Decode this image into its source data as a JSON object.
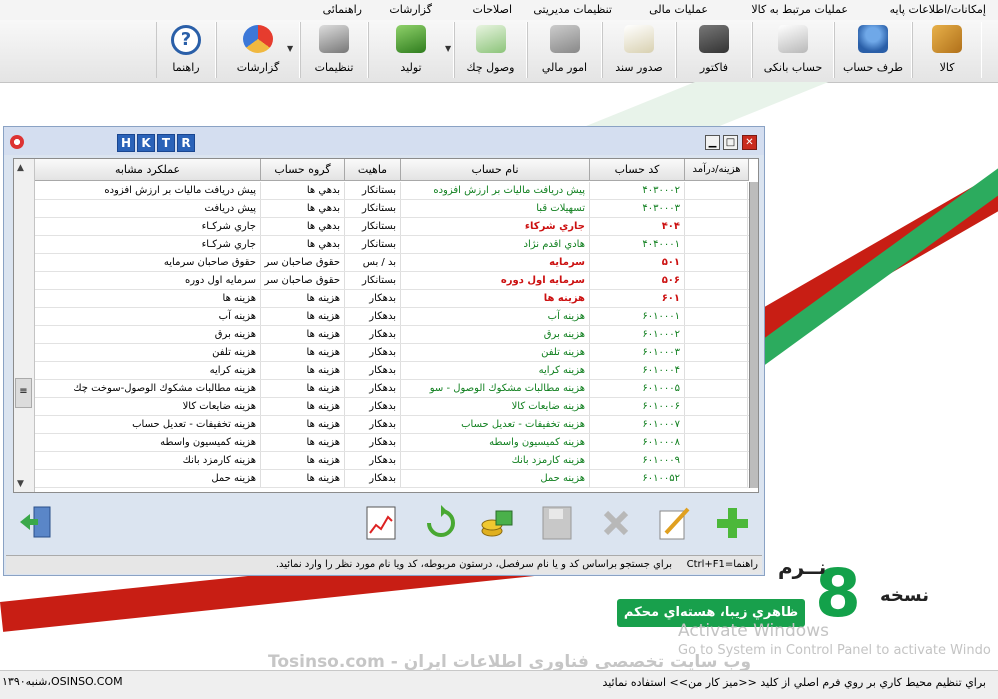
{
  "menu": [
    "إمکانات/اطلاعات پایه",
    "عملیات مرتبط به کالا",
    "عملیات مالی",
    "تنظیمات مدیریتی",
    "اصلاحات",
    "گزارشات",
    "راهنمائی"
  ],
  "toolbar": [
    {
      "label": "کالا",
      "icon": "box-icon"
    },
    {
      "label": "طرف حساب",
      "icon": "person-icon"
    },
    {
      "label": "حساب بانکی",
      "icon": "bank-icon"
    },
    {
      "label": "فاکتور",
      "icon": "calculator-icon"
    },
    {
      "label": "صدور سند",
      "icon": "document-icon"
    },
    {
      "label": "امور مالي",
      "icon": "calc-icon"
    },
    {
      "label": "وصول چك",
      "icon": "check-icon"
    },
    {
      "label": "توليد",
      "icon": "production-icon"
    },
    {
      "label": "تنظيمات",
      "icon": "tools-icon"
    },
    {
      "label": "گزارشات",
      "icon": "chart-icon"
    },
    {
      "label": "راهنما",
      "icon": "help-icon"
    }
  ],
  "window": {
    "hktr": [
      "H",
      "K",
      "T",
      "R"
    ],
    "columns": {
      "cost": "هزینه/درآمد",
      "code": "کد حساب",
      "name": "نام حساب",
      "nature": "ماهیت",
      "group": "گروه حساب",
      "usage": "عملکرد مشابه"
    },
    "rows": [
      {
        "code": "۴۰۳۰۰۰۲",
        "name": "پیش دریافت مالیات بر ارزش افزوده",
        "nature": "بستانکار",
        "group": "بدهي ها",
        "usage": "پيش دريافت ماليات بر ارزش افزوده",
        "bold": false
      },
      {
        "code": "۴۰۳۰۰۰۳",
        "name": "تسهيلات قبا",
        "nature": "بستانکار",
        "group": "بدهي ها",
        "usage": "پيش دريافت",
        "bold": false
      },
      {
        "code": "۴۰۴",
        "name": "جاري شرکاء",
        "nature": "بستانکار",
        "group": "بدهي ها",
        "usage": "جاري شرکـاء",
        "bold": true
      },
      {
        "code": "۴۰۴۰۰۰۱",
        "name": "هادي  اقدم نژاد",
        "nature": "بستانکار",
        "group": "بدهي ها",
        "usage": "جاري شرکـاء",
        "bold": false
      },
      {
        "code": "۵۰۱",
        "name": "سرمايه",
        "nature": "بد / بس",
        "group": "حقوق صاحبان سر",
        "usage": "حقوق صاحبان سرمايه",
        "bold": true
      },
      {
        "code": "۵۰۶",
        "name": "سرمايه اول دوره",
        "nature": "بستانکار",
        "group": "حقوق صاحبان سر",
        "usage": "سرمايه اول دوره",
        "bold": true
      },
      {
        "code": "۶۰۱",
        "name": "هزينه ها",
        "nature": "بدهکار",
        "group": "هزینه ها",
        "usage": "هزينه ها",
        "bold": true
      },
      {
        "code": "۶۰۱۰۰۰۱",
        "name": "هزينه آب",
        "nature": "بدهکار",
        "group": "هزینه ها",
        "usage": "هزينه آب",
        "bold": false
      },
      {
        "code": "۶۰۱۰۰۰۲",
        "name": "هزينه برق",
        "nature": "بدهکار",
        "group": "هزینه ها",
        "usage": "هزينه برق",
        "bold": false
      },
      {
        "code": "۶۰۱۰۰۰۳",
        "name": "هزينه تلفن",
        "nature": "بدهکار",
        "group": "هزینه ها",
        "usage": "هزينه تلفن",
        "bold": false
      },
      {
        "code": "۶۰۱۰۰۰۴",
        "name": "هزينه کرايه",
        "nature": "بدهکار",
        "group": "هزینه ها",
        "usage": "هزينه کرايه",
        "bold": false
      },
      {
        "code": "۶۰۱۰۰۰۵",
        "name": "هزينه مطالبات مشکوك الوصول - سو",
        "nature": "بدهکار",
        "group": "هزینه ها",
        "usage": "هزينه مطالبات مشکوك الوصول-سوخت چك",
        "bold": false
      },
      {
        "code": "۶۰۱۰۰۰۶",
        "name": "هزينه ضايعات کالا",
        "nature": "بدهکار",
        "group": "هزینه ها",
        "usage": "هزينه ضايعات کالا",
        "bold": false
      },
      {
        "code": "۶۰۱۰۰۰۷",
        "name": "هزينه تخفيفات - تعديل حساب",
        "nature": "بدهکار",
        "group": "هزینه ها",
        "usage": "هزينه تخفيفات - تعديل حساب",
        "bold": false
      },
      {
        "code": "۶۰۱۰۰۰۸",
        "name": "هزينه کميسيون واسطه",
        "nature": "بدهکار",
        "group": "هزینه ها",
        "usage": "هزينه کميسيون واسطه",
        "bold": false
      },
      {
        "code": "۶۰۱۰۰۰۹",
        "name": "هزينه کارمزد بانك",
        "nature": "بدهکار",
        "group": "هزینه ها",
        "usage": "هزينه کارمزد بانك",
        "bold": false
      },
      {
        "code": "۶۰۱۰۰۵۲",
        "name": "هزينه حمل",
        "nature": "بدهکار",
        "group": "هزینه ها",
        "usage": "هزينه حمل",
        "bold": false
      }
    ],
    "hint_key": "راهنما=Ctrl+F1",
    "hint_msg": "براي جستجو براساس کد و يا نام سرفصل، درستون مربوطه، کد ويا نام مورد نظر را وارد نمائيد."
  },
  "brand": {
    "version_word": "نسخه",
    "version_number": "8",
    "arc_text": "نــرم",
    "badge": "ظاهري زيبا، هسته‌اي محکم"
  },
  "activation": {
    "title": "Activate Windows",
    "sub": "Go to System in Control Panel to activate Windo"
  },
  "watermark": "Tosinso.com - وب سایت تخصصی فناوری اطلاعات ایران",
  "status": {
    "message": "براي تنظيم محيط کاري بر روي فرم اصلي از کليد <<ميز کار من>> استفاده نمائيد",
    "left": "۱۳۹۰شنبه،OSINSO.COM"
  },
  "colors": {
    "accent_green": "#13a14a",
    "bold_red": "#cc1010",
    "name_green": "#0f7f1e"
  }
}
